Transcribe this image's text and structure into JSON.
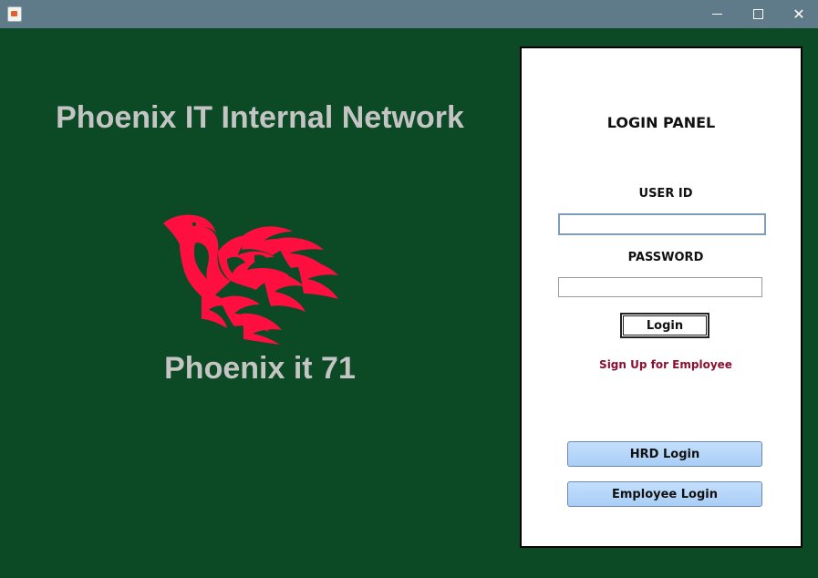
{
  "window": {
    "controls": {
      "minimize_icon": "minimize-icon",
      "maximize_icon": "maximize-icon",
      "close_glyph": "✕"
    }
  },
  "left": {
    "title": "Phoenix IT Internal Network",
    "logo_icon": "phoenix-bird-logo",
    "logo_color": "#ff0f3f",
    "caption": "Phoenix it 71"
  },
  "login_panel": {
    "title": "LOGIN PANEL",
    "user_id_label": "USER ID",
    "user_id_value": "",
    "password_label": "PASSWORD",
    "password_value": "",
    "login_button": "Login",
    "signup_link": "Sign Up for Employee",
    "hrd_login_button": "HRD Login",
    "employee_login_button": "Employee Login"
  },
  "colors": {
    "background": "#0b4a24",
    "titlebar": "#5f7a88",
    "heading_text": "#c4c4c4",
    "link": "#8a1030",
    "blue_button": "#b3d5fa"
  }
}
